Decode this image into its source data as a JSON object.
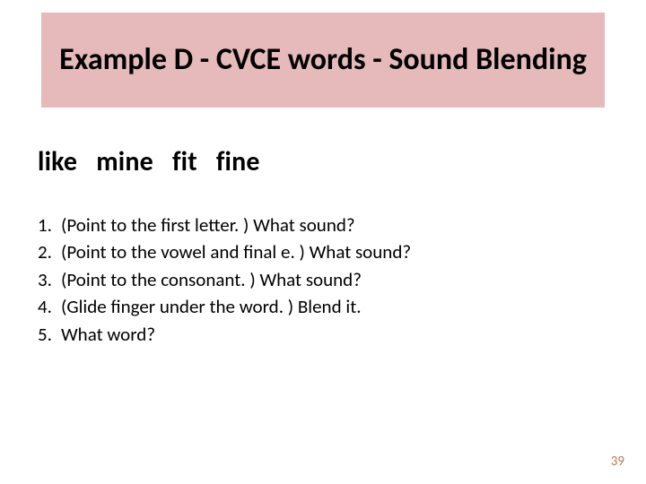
{
  "title": "Example D - CVCE words - Sound Blending",
  "words": [
    "like",
    "mine",
    "fit",
    "fine"
  ],
  "steps": [
    {
      "n": "1.",
      "t": "(Point to the first letter. ) What sound?"
    },
    {
      "n": "2.",
      "t": "(Point to the vowel and final e. ) What sound?"
    },
    {
      "n": "3.",
      "t": " (Point to the consonant. ) What sound?"
    },
    {
      "n": "4.",
      "t": "(Glide finger under the word. )  Blend it."
    },
    {
      "n": "5.",
      "t": "What word?"
    }
  ],
  "page_number": "39"
}
